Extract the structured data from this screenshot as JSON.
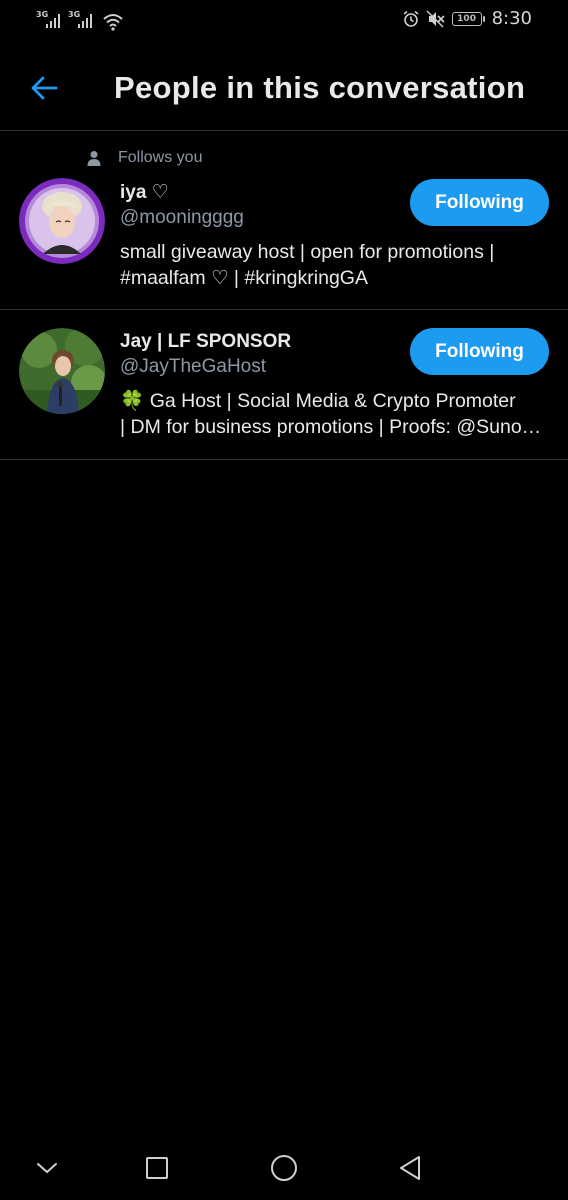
{
  "status_bar": {
    "network_1": "3G",
    "network_2": "3G",
    "battery": "100",
    "time": "8:30"
  },
  "header": {
    "title": "People in this conversation",
    "back_icon": "arrow-left-icon",
    "accent_color": "#1d9bf0"
  },
  "users": [
    {
      "follows_you": "Follows you",
      "display_name": "iya ♡",
      "handle": "@mooningggg",
      "bio_line_1": "small giveaway host | open for promotions |",
      "bio_line_2": "#maalfam ♡ | #kringkringGA",
      "follow_label": "Following"
    },
    {
      "display_name": "Jay | LF SPONSOR",
      "handle": "@JayTheGaHost",
      "bio_line_1": "🍀 Ga Host | Social Media & Crypto Promoter",
      "bio_line_2": "| DM for business promotions | Proofs: @Suno…",
      "follow_label": "Following"
    }
  ],
  "nav": {
    "icons": [
      "chevron-down-icon",
      "square-recents-icon",
      "circle-home-icon",
      "triangle-back-icon"
    ]
  }
}
